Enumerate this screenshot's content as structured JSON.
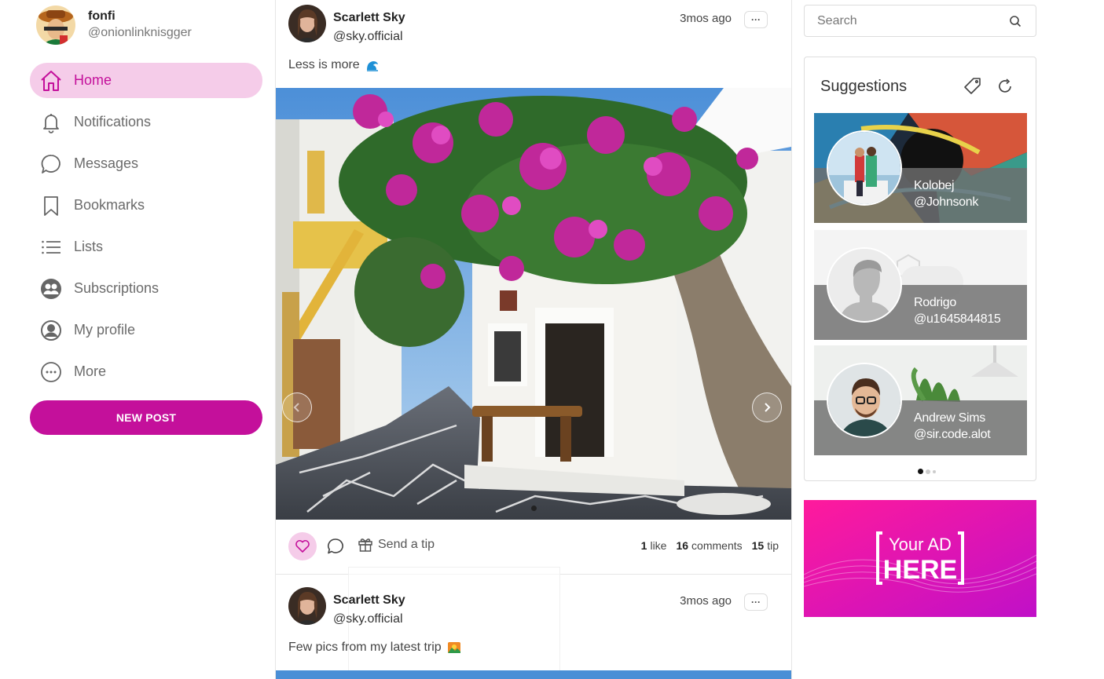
{
  "user": {
    "name": "fonfi",
    "handle": "@onionlinknisgger"
  },
  "nav": [
    {
      "label": "Home",
      "icon": "home-icon",
      "active": true
    },
    {
      "label": "Notifications",
      "icon": "bell-icon"
    },
    {
      "label": "Messages",
      "icon": "chat-bubble-icon"
    },
    {
      "label": "Bookmarks",
      "icon": "bookmark-icon"
    },
    {
      "label": "Lists",
      "icon": "list-icon"
    },
    {
      "label": "Subscriptions",
      "icon": "users-icon"
    },
    {
      "label": "My profile",
      "icon": "user-circle-icon"
    },
    {
      "label": "More",
      "icon": "more-dots-icon"
    }
  ],
  "new_post_label": "NEW POST",
  "posts": [
    {
      "name": "Scarlett Sky",
      "handle": "@sky.official",
      "time": "3mos ago",
      "menu": "···",
      "text": "Less is more",
      "text_emoji": "wave-emoji",
      "likes": "1",
      "likes_label": "like",
      "comments": "16",
      "comments_label": "comments",
      "tips": "15",
      "tips_label": "tip",
      "send_tip_label": "Send a tip"
    },
    {
      "name": "Scarlett Sky",
      "handle": "@sky.official",
      "time": "3mos ago",
      "menu": "···",
      "text": "Few pics from my latest trip",
      "text_emoji": "mountain-sunrise-emoji"
    }
  ],
  "search": {
    "placeholder": "Search"
  },
  "suggestions": {
    "title": "Suggestions",
    "items": [
      {
        "name": "Kolobej",
        "handle": "@Johnsonk"
      },
      {
        "name": "Rodrigo",
        "handle": "@u1645844815"
      },
      {
        "name": "Andrew Sims",
        "handle": "@sir.code.alot"
      }
    ]
  },
  "ad": {
    "line1": "Your AD",
    "line2": "HERE"
  },
  "colors": {
    "accent": "#c4109b",
    "accent_light": "#f5cce9",
    "ad_gradient_start": "#ff1a9c",
    "ad_gradient_end": "#c010c8"
  }
}
